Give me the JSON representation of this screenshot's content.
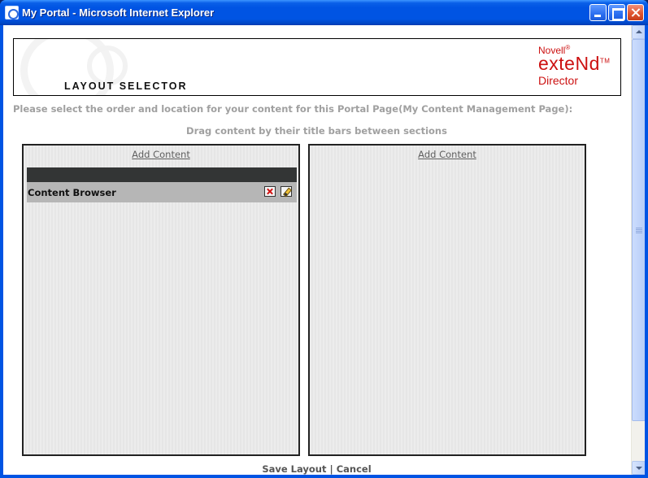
{
  "window": {
    "title": "My Portal - Microsoft Internet Explorer",
    "icon": "ie-icon",
    "controls": [
      "minimize-icon",
      "maximize-icon",
      "close-icon"
    ]
  },
  "banner": {
    "title": "LAYOUT SELECTOR",
    "brand_line1": "Novell",
    "brand_line1_mark": "®",
    "brand_line2": "exteNd",
    "brand_line2_mark": "TM",
    "brand_line3": "Director"
  },
  "instructions": "Please select the order and location for your content for this Portal Page(My Content Management Page):",
  "drag_hint": "Drag content by their title bars between sections",
  "columns": [
    {
      "add_label": "Add Content",
      "portlets": [
        {
          "title": "Content Browser",
          "actions": [
            "remove-icon",
            "edit-icon"
          ]
        }
      ]
    },
    {
      "add_label": "Add Content",
      "portlets": []
    }
  ],
  "footer": {
    "save_label": "Save Layout",
    "separator": "|",
    "cancel_label": "Cancel"
  },
  "colors": {
    "titlebar": "#0054e3",
    "brand_red": "#cc1111",
    "muted_text": "#a0a0a0"
  }
}
